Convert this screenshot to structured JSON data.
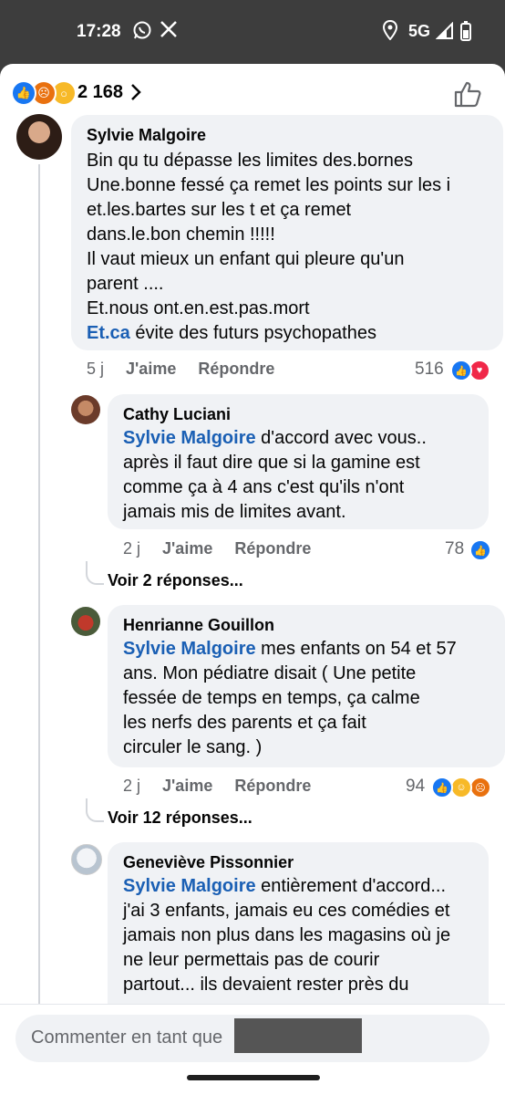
{
  "status_bar": {
    "time": "17:28",
    "network": "5G"
  },
  "header": {
    "reaction_count": "2 168"
  },
  "comments": [
    {
      "author": "Sylvie Malgoire",
      "lines": "Bin qu tu dépasse les limites des.bornes\nUne.bonne fessé ça remet les points sur les i\net.les.bartes sur les t et ça remet\ndans.le.bon chemin !!!!!\nIl vaut mieux un enfant qui pleure qu'un\nparent ....\nEt.nous ont.en.est.pas.mort",
      "link": "Et.ca",
      "last_line": " évite des futurs psychopathes",
      "time": "5 j",
      "like": "J'aime",
      "reply": "Répondre",
      "count": "516"
    },
    {
      "author": "Cathy Luciani",
      "mention": "Sylvie Malgoire",
      "text_first": " d'accord avec vous..",
      "lines": "après il faut dire que si la gamine est\ncomme ça à 4 ans c'est qu'ils n'ont\njamais mis de limites avant.",
      "time": "2 j",
      "like": "J'aime",
      "reply": "Répondre",
      "count": "78",
      "more": "Voir 2 réponses..."
    },
    {
      "author": "Henrianne Gouillon",
      "mention": "Sylvie Malgoire",
      "text_first": " mes enfants  on 54 et 57",
      "lines": "ans. Mon pédiatre  disait  ( Une petite\nfessée  de  temps  en temps, ça  calme\nles nerfs  des parents  et  ça  fait\ncirculer  le  sang. )",
      "time": "2 j",
      "like": "J'aime",
      "reply": "Répondre",
      "count": "94",
      "more": "Voir 12 réponses..."
    },
    {
      "author": "Geneviève Pissonnier",
      "mention": "Sylvie Malgoire",
      "text_first": "   entièrement d'accord...",
      "lines": "j'ai 3 enfants, jamais eu ces comédies et\njamais non plus dans les magasins où je\nne leur permettais pas de courir\npartout... ils devaient rester près du"
    }
  ],
  "composer": {
    "placeholder": "Commenter en tant que"
  },
  "colors": {
    "like": "#1877f2",
    "love": "#f02849",
    "haha": "#f7b928",
    "angry": "#e9710f"
  }
}
